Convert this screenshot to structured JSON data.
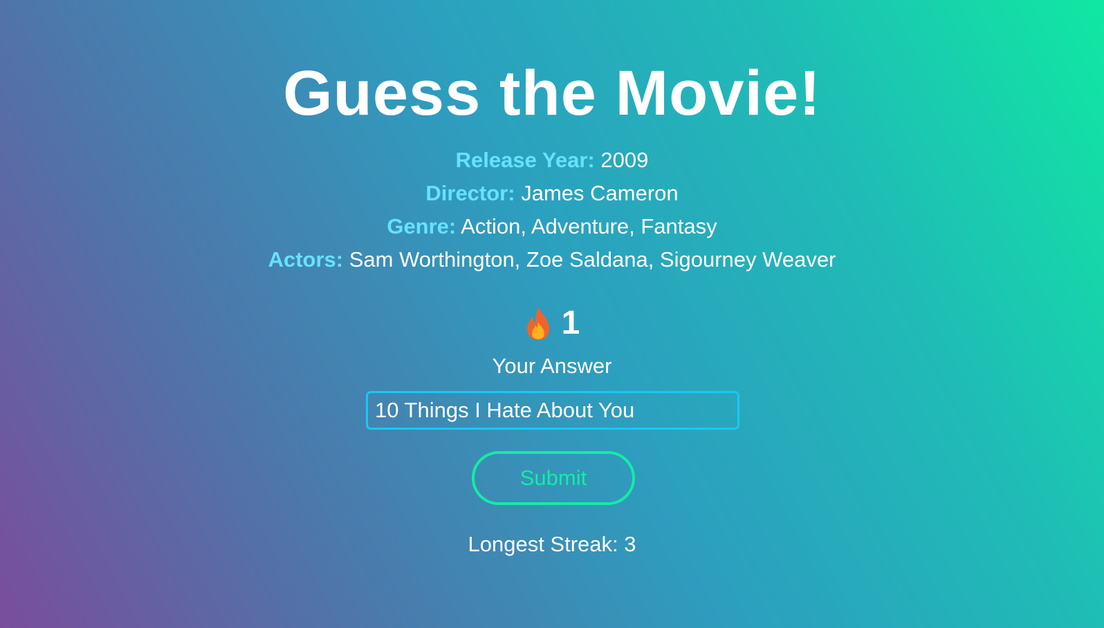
{
  "title": "Guess the Movie!",
  "clues": {
    "release_year": {
      "label": "Release Year:",
      "value": "2009"
    },
    "director": {
      "label": "Director:",
      "value": "James Cameron"
    },
    "genre": {
      "label": "Genre:",
      "value": "Action, Adventure, Fantasy"
    },
    "actors": {
      "label": "Actors:",
      "value": "Sam Worthington, Zoe Saldana, Sigourney Weaver"
    }
  },
  "streak": {
    "icon": "fire-icon",
    "count": "1"
  },
  "answer": {
    "label": "Your Answer",
    "value": "10 Things I Hate About You",
    "placeholder": ""
  },
  "submit": {
    "label": "Submit"
  },
  "longest_streak": {
    "text": "Longest Streak: 3"
  },
  "colors": {
    "clue_label": "#66e2ff",
    "input_border": "#19c9f2",
    "submit_accent": "#12eda5",
    "gradient_start": "#7a4d9a",
    "gradient_end": "#10e8a2"
  }
}
